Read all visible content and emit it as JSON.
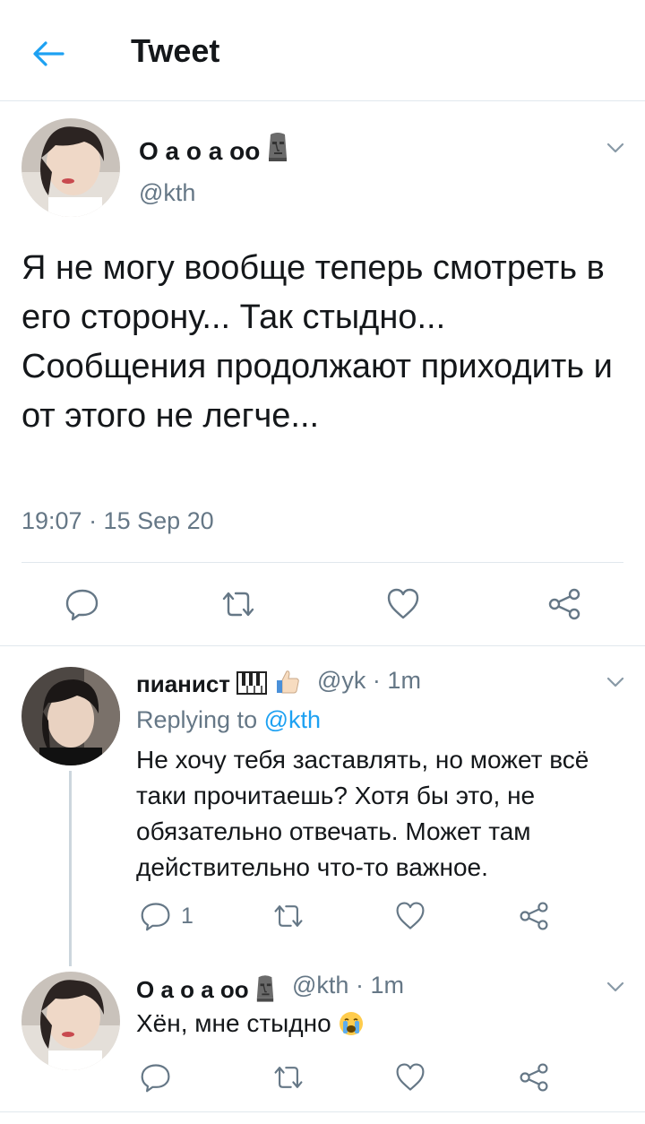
{
  "header": {
    "title": "Tweet"
  },
  "tweet": {
    "name": "О а о а оо",
    "handle": "@kth",
    "text": "Я не могу вообще теперь смотреть в его сторону... Так стыдно... Сообщения продолжают приходить и от этого не легче...",
    "timestamp": "19:07 · 15 Sep 20"
  },
  "replies": [
    {
      "name": "пианист",
      "handle": "@yk",
      "time": "1m",
      "replying_prefix": "Replying to ",
      "replying_to": "@kth",
      "text": "Не хочу тебя заставлять, но может всё таки прочитаешь? Хотя бы это, не обязательно отвечать. Может там действительно что-то важное.",
      "reply_count": "1"
    },
    {
      "name": "О а о а оо",
      "handle": "@kth",
      "time": "1m",
      "text": "Хён, мне стыдно",
      "reply_count": ""
    }
  ],
  "colors": {
    "accent": "#1da1f2",
    "secondary_text": "#657786",
    "icon_gray": "#657786",
    "divider": "#e1e8ed"
  },
  "icons": [
    "back-arrow-icon",
    "chevron-down-icon",
    "reply-icon",
    "retweet-icon",
    "like-icon",
    "share-icon",
    "moai-emoji",
    "piano-emoji",
    "thumbs-up-emoji",
    "crying-emoji"
  ]
}
